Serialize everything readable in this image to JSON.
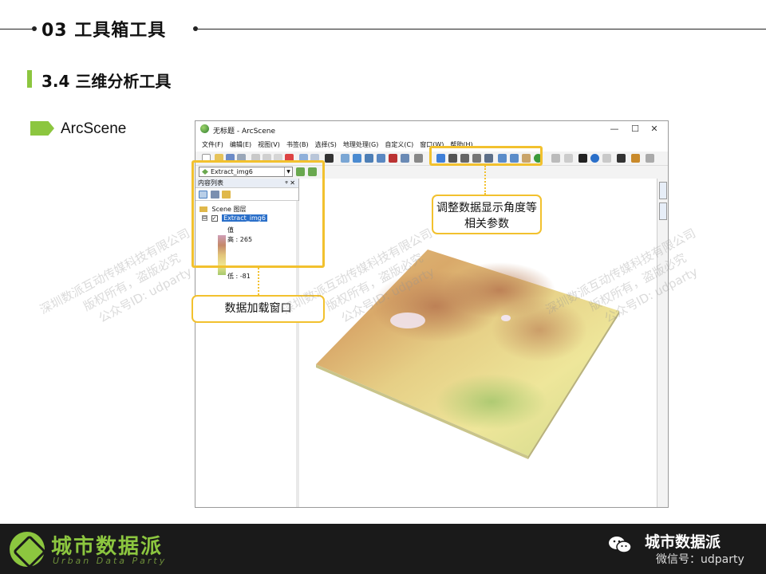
{
  "slide": {
    "section_title": "03 工具箱工具",
    "subsection_title": "3.4 三维分析工具",
    "tag_label": "ArcScene"
  },
  "app": {
    "window_title": "无标题 - ArcScene",
    "minimize": "—",
    "maximize": "☐",
    "close": "✕",
    "menu": [
      "文件(F)",
      "编辑(E)",
      "视图(V)",
      "书签(B)",
      "选择(S)",
      "地理处理(G)",
      "自定义(C)",
      "窗口(W)",
      "帮助(H)"
    ],
    "layer_dropdown_value": "Extract_img6",
    "toc": {
      "header": "内容列表",
      "pin": "ᵠ ✕",
      "scene_layer": "Scene 图层",
      "expander": "⊟",
      "checkbox": "✓",
      "layer_name": "Extract_img6",
      "legend_title": "值",
      "legend_high": "高 : 265",
      "legend_low": "低 : -81"
    }
  },
  "callouts": {
    "navigation": "调整数据显示角度等相关参数",
    "data_loading": "数据加载窗口"
  },
  "watermark": {
    "line1": "深圳数派互动传媒科技有限公司",
    "line2": "版权所有，盗版必究",
    "line3": "公众号ID: udparty"
  },
  "footer": {
    "logo_cn": "城市数据派",
    "logo_en": "Urban Data Party",
    "wechat_name": "城市数据派",
    "wechat_id": "微信号：udparty"
  },
  "colors": {
    "accent_green": "#8cc63f",
    "highlight_yellow": "#f2c12e",
    "footer_bg": "#1a1a1a"
  },
  "icons": [
    "app-globe-icon",
    "wechat-icon",
    "navigate-icon",
    "zoom-in-icon",
    "zoom-out-icon",
    "pan-hand-icon",
    "full-extent-globe-icon",
    "identify-icon",
    "find-binoculars-icon"
  ]
}
